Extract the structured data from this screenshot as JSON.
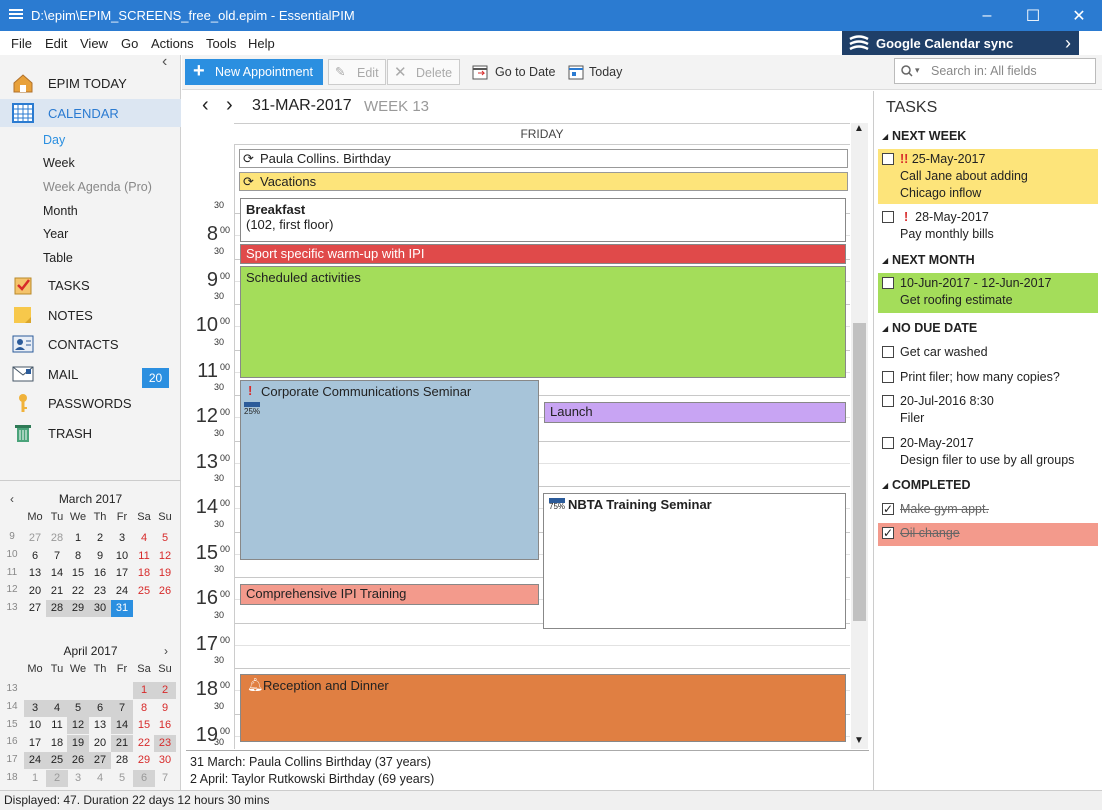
{
  "window": {
    "title": "D:\\epim\\EPIM_SCREENS_free_old.epim - EssentialPIM",
    "minimize": "–",
    "maximize": "☐",
    "close": "✕"
  },
  "menu": [
    "File",
    "Edit",
    "View",
    "Go",
    "Actions",
    "Tools",
    "Help"
  ],
  "gsync": {
    "label": "Google Calendar sync",
    "arrow": "›"
  },
  "sidebar": {
    "collapse": "‹",
    "items": [
      {
        "label": "EPIM TODAY",
        "icon": "house-icon"
      },
      {
        "label": "CALENDAR",
        "icon": "calendar-icon"
      },
      {
        "label": "TASKS",
        "icon": "tasks-icon"
      },
      {
        "label": "NOTES",
        "icon": "notes-icon"
      },
      {
        "label": "CONTACTS",
        "icon": "contacts-icon"
      },
      {
        "label": "MAIL",
        "icon": "mail-icon",
        "badge": "20"
      },
      {
        "label": "PASSWORDS",
        "icon": "key-icon"
      },
      {
        "label": "TRASH",
        "icon": "trash-icon"
      }
    ],
    "views": [
      "Day",
      "Week",
      "Week Agenda (Pro)",
      "Month",
      "Year",
      "Table"
    ]
  },
  "minical": {
    "march": {
      "title": "March  2017",
      "weeks": [
        "9",
        "10",
        "11",
        "12",
        "13"
      ]
    },
    "april": {
      "title": "April  2017",
      "weeks": [
        "13",
        "14",
        "15",
        "16",
        "17",
        "18"
      ]
    },
    "dows": [
      "Mo",
      "Tu",
      "We",
      "Th",
      "Fr",
      "Sa",
      "Su"
    ]
  },
  "toolbar": {
    "new": "New Appointment",
    "edit": "Edit",
    "delete": "Delete",
    "goto": "Go to Date",
    "today": "Today",
    "search_placeholder": "Search in: All fields"
  },
  "view": {
    "prev": "‹",
    "next": "›",
    "date": "31-MAR-2017",
    "week": "WEEK 13",
    "dayname": "FRIDAY"
  },
  "allday": [
    {
      "title": "Paula Collins. Birthday",
      "color": "#ffffff"
    },
    {
      "title": "Vacations",
      "color": "#fde47a"
    }
  ],
  "hours": [
    "8",
    "9",
    "10",
    "11",
    "12",
    "13",
    "14",
    "15",
    "16",
    "17",
    "18",
    "19"
  ],
  "events": {
    "breakfast": {
      "title": "Breakfast",
      "sub": "(102, first floor)"
    },
    "sport": {
      "title": "Sport specific warm-up with IPI"
    },
    "scheduled": {
      "title": "Scheduled activities"
    },
    "corporate": {
      "title": "Corporate Communications Seminar",
      "progress": "25%"
    },
    "launch": {
      "title": "Launch"
    },
    "nbta": {
      "title": "NBTA Training Seminar",
      "progress": "75%"
    },
    "ipi": {
      "title": "Comprehensive IPI Training"
    },
    "reception": {
      "title": "Reception and Dinner"
    }
  },
  "birthdays": [
    "31 March:  Paula Collins Birthday  (37 years)",
    "2 April:  Taylor Rutkowski Birthday  (69 years)"
  ],
  "status": "Displayed: 47. Duration 22 days 12 hours 30 mins",
  "tasks": {
    "title": "TASKS",
    "groups": {
      "next_week": "NEXT WEEK",
      "next_month": "NEXT MONTH",
      "no_due": "NO DUE DATE",
      "completed": "COMPLETED"
    },
    "items": [
      {
        "date": "25-May-2017",
        "text1": "Call Jane about adding",
        "text2": "Chicago inflow",
        "pri": "!!"
      },
      {
        "date": "28-May-2017",
        "text1": "Pay monthly bills",
        "pri": "!"
      },
      {
        "date": "10-Jun-2017 - 12-Jun-2017",
        "text1": "Get roofing estimate"
      },
      {
        "text1": "Get car washed"
      },
      {
        "text1": "Print filer; how many copies?"
      },
      {
        "date": "20-Jul-2016 8:30",
        "text1": "Filer"
      },
      {
        "date": "20-May-2017",
        "text1": "Design filer to use by all groups"
      },
      {
        "text1": "Make gym appt."
      },
      {
        "text1": "Oil change"
      }
    ]
  }
}
